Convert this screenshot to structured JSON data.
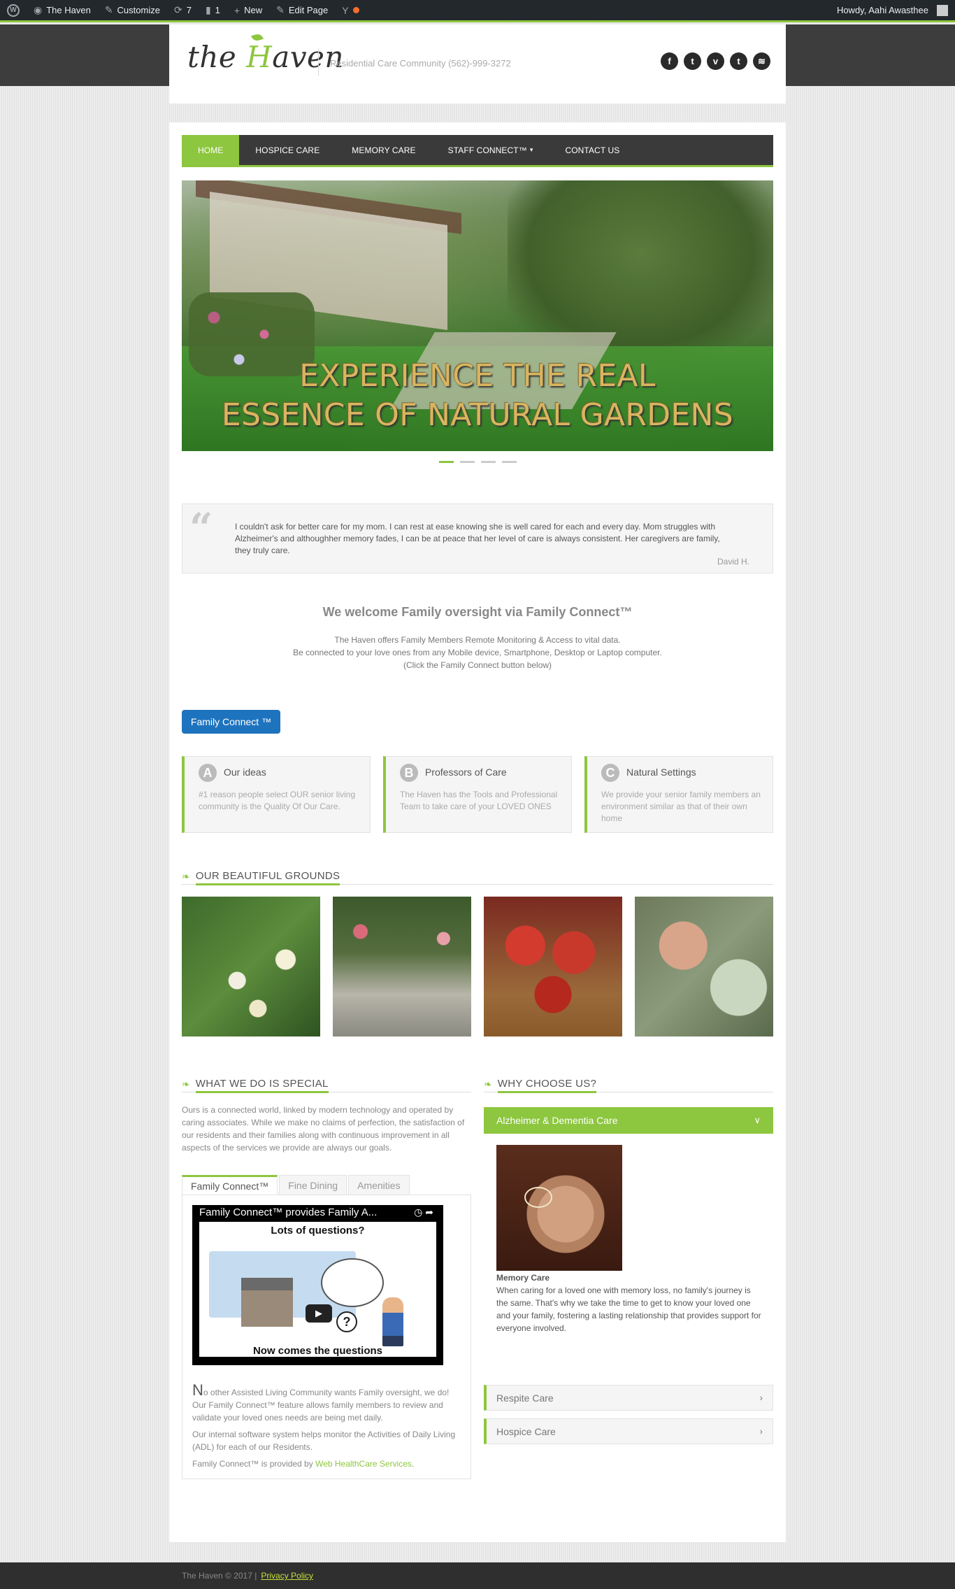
{
  "adminbar": {
    "site_name": "The Haven",
    "customize": "Customize",
    "updates_count": "7",
    "comments_count": "1",
    "new_label": "New",
    "edit_page": "Edit Page",
    "howdy": "Howdy, Aahi Awasthee"
  },
  "header": {
    "logo_prefix": "the ",
    "logo_h": "H",
    "logo_rest": "aven",
    "tagline": "Residential Care Community (562)-999-3272",
    "socials": [
      "f",
      "t",
      "v",
      "t",
      "rss"
    ]
  },
  "nav": {
    "items": [
      "HOME",
      "HOSPICE CARE",
      "MEMORY CARE",
      "STAFF CONNECT™",
      "CONTACT US"
    ]
  },
  "hero": {
    "caption_line1": "EXPERIENCE THE REAL",
    "caption_line2": "ESSENCE OF NATURAL GARDENS"
  },
  "testimonial": {
    "text": "I couldn't ask for better care for my mom. I can rest at ease knowing she is well cared for each and every day. Mom struggles with Alzheimer's and althoughher memory fades, I can be at peace that her level of care is always consistent. Her caregivers are family, they truly care.",
    "author": "David H."
  },
  "welcome": {
    "title": "We welcome Family oversight via Family Connect™",
    "line1": "The Haven offers Family Members Remote Monitoring & Access to vital data.",
    "line2": "Be connected to your love ones from any Mobile device, Smartphone, Desktop or Laptop computer.",
    "line3": "(Click the Family Connect button below)"
  },
  "family_connect_button": "Family Connect ™",
  "features": [
    {
      "badge": "A",
      "title": "Our ideas",
      "text": "#1 reason people select OUR senior living community is the Quality Of Our Care."
    },
    {
      "badge": "B",
      "title": "Professors of Care",
      "text": "The Haven has the Tools and Professional Team to take care of your LOVED ONES"
    },
    {
      "badge": "C",
      "title": "Natural Settings",
      "text": "We provide your senior family members an environment similar as that of their own home"
    }
  ],
  "grounds": {
    "title": "OUR BEAUTIFUL GROUNDS"
  },
  "special": {
    "title": "WHAT WE DO IS SPECIAL",
    "text": "Ours is a connected world, linked by modern technology and operated by caring associates. While we make no claims of perfection, the satisfaction of our residents and their families along with continuous improvement in all aspects of the services we provide are always our goals.",
    "tabs": [
      "Family Connect™",
      "Fine Dining",
      "Amenities"
    ],
    "video_title": "Family Connect™ provides Family A...",
    "video_top_text": "Lots of questions?",
    "video_bottom_text": "Now comes the questions",
    "p1_cap": "N",
    "p1_rest": "o other Assisted Living Community wants Family oversight, we do! Our Family Connect™ feature allows family members to review and validate your loved ones needs are being met daily.",
    "p2": "Our internal software system helps monitor the Activities of Daily Living (ADL) for each of our Residents.",
    "p3_prefix": "Family Connect™ is provided by ",
    "p3_link": "Web HealthCare Services",
    "p3_suffix": "."
  },
  "why": {
    "title": "WHY CHOOSE US?",
    "open_item": "Alzheimer & Dementia Care",
    "body_title": "Memory Care",
    "body_text": "When caring for a loved one with memory loss, no family's journey is the same. That's why we take the time to get to know your loved one and your family, fostering a lasting relationship that provides support for everyone involved.",
    "items": [
      "Respite Care",
      "Hospice Care"
    ]
  },
  "footer": {
    "copyright": "The Haven  ©  2017  |",
    "privacy": "Privacy Policy"
  },
  "colors": {
    "accent": "#8dc63f",
    "button_blue": "#1e73be",
    "adminbar": "#23282d"
  }
}
